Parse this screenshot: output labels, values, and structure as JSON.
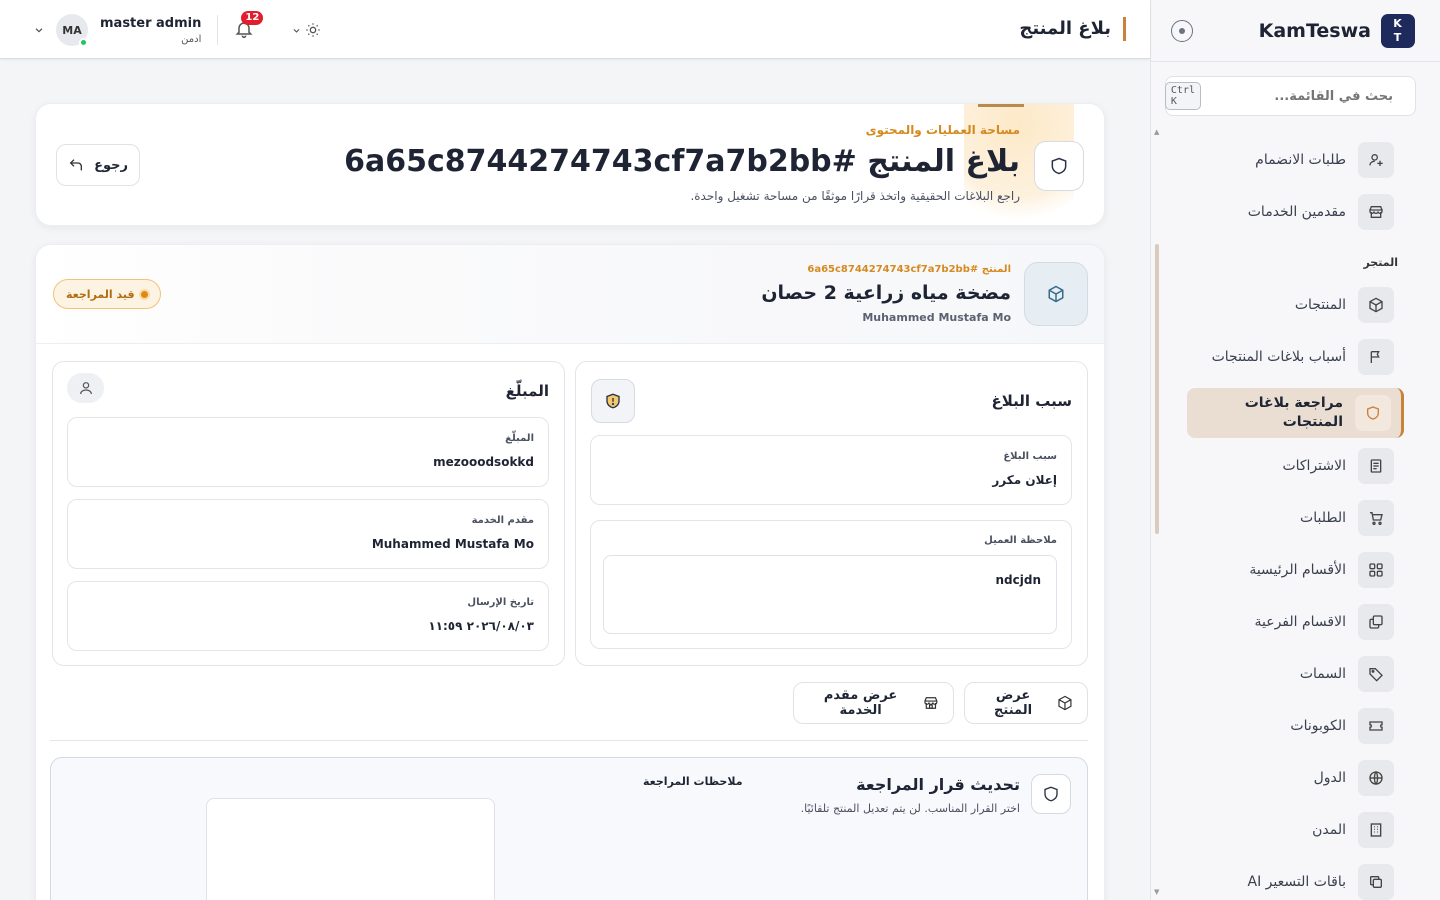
{
  "app": {
    "brand": "KamTeswa",
    "logo_line1": "K",
    "logo_line2": "T"
  },
  "search": {
    "placeholder": "بحث في القائمة...",
    "shortcut": "Ctrl K"
  },
  "sidebar": {
    "items_top": [
      {
        "label": "طلبات الانضمام",
        "icon": "user-plus-icon"
      },
      {
        "label": "مقدمين الخدمات",
        "icon": "store-icon"
      }
    ],
    "section_label": "المتجر",
    "items": [
      {
        "label": "المنتجات",
        "icon": "box-icon"
      },
      {
        "label": "أسباب بلاغات المنتجات",
        "icon": "flag-icon"
      },
      {
        "label": "مراجعة بلاغات المنتجات",
        "icon": "shield-icon",
        "active": true
      },
      {
        "label": "الاشتراكات",
        "icon": "receipt-icon"
      },
      {
        "label": "الطلبات",
        "icon": "cart-icon"
      },
      {
        "label": "الأقسام الرئيسية",
        "icon": "grid-icon"
      },
      {
        "label": "الاقسام الفرعية",
        "icon": "layers-icon"
      },
      {
        "label": "السمات",
        "icon": "tag-icon"
      },
      {
        "label": "الكوبونات",
        "icon": "ticket-icon"
      },
      {
        "label": "الدول",
        "icon": "globe-icon"
      },
      {
        "label": "المدن",
        "icon": "building-icon"
      },
      {
        "label": "باقات التسعير AI",
        "icon": "copy-icon"
      }
    ]
  },
  "topbar": {
    "page_title": "بلاغ المنتج",
    "notifications_count": "12",
    "user_name": "master admin",
    "user_role": "ادمن",
    "avatar_initials": "MA"
  },
  "hero": {
    "kicker": "مساحة العمليات والمحتوى",
    "title": "بلاغ المنتج #6a65c8744274743cf7a7b2bb",
    "subtitle": "راجع البلاغات الحقيقية واتخذ قرارًا موثقًا من مساحة تشغيل واحدة.",
    "back_label": "رجوع"
  },
  "product": {
    "id_label": "المنتج #6a65c8744274743cf7a7b2bb",
    "name": "مضخة مياه زراعية 2 حصان",
    "owner": "Muhammed Mustafa Mo",
    "status": "قيد المراجعة",
    "status_color": "#e08a14"
  },
  "reason_panel": {
    "title": "سبب البلاغ",
    "reason_label": "سبب البلاغ",
    "reason_value": "إعلان مكرر",
    "note_label": "ملاحظة العميل",
    "note_value": "ndcjdn"
  },
  "reporter_panel": {
    "title": "المبلّغ",
    "reporter_label": "المبلّغ",
    "reporter_value": "mezooodsokkd",
    "provider_label": "مقدم الخدمة",
    "provider_value": "Muhammed Mustafa Mo",
    "date_label": "تاريخ الإرسال",
    "date_value": "٢٠٢٦/٠٨/٠٣ ١١:٥٩"
  },
  "actions": {
    "view_product": "عرض المنتج",
    "view_provider": "عرض مقدم الخدمة"
  },
  "decision": {
    "title": "تحديث قرار المراجعة",
    "subtitle": "اختر القرار المناسب. لن يتم تعديل المنتج تلقائيًا.",
    "notes_label": "ملاحظات المراجعة"
  },
  "colors": {
    "accent": "#c9823a",
    "brand_navy": "#1f2a5c",
    "badge_red": "#e11d2e",
    "online_green": "#22c55e"
  }
}
